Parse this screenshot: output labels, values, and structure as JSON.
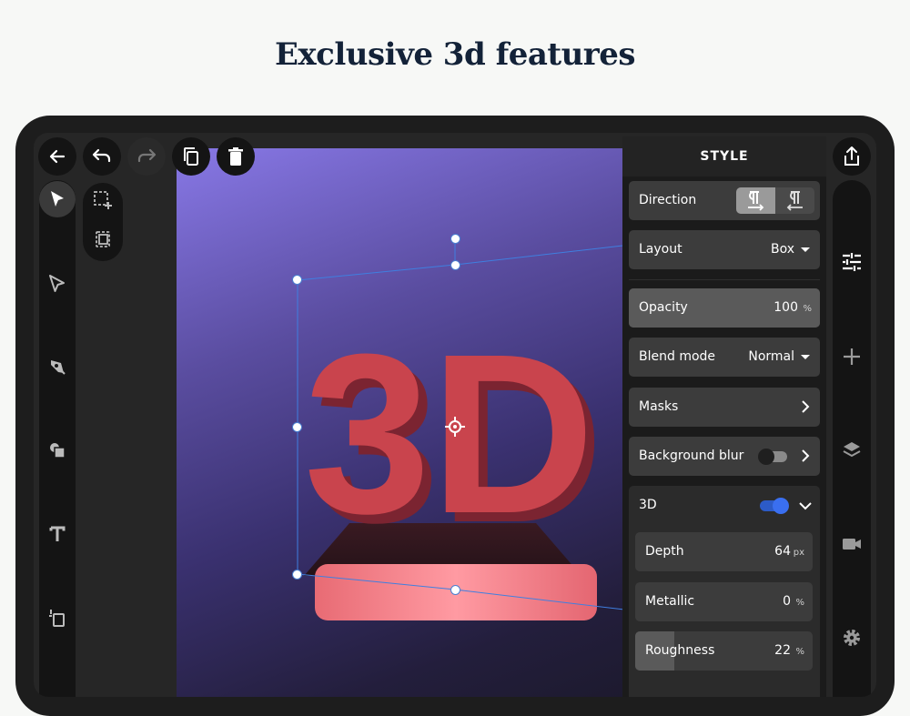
{
  "headline": "Exclusive 3d features",
  "artwork": {
    "text_3d": "3D"
  },
  "style_panel": {
    "title": "STYLE",
    "direction": {
      "label": "Direction",
      "options": [
        "ltr-paragraph-icon",
        "rtl-paragraph-icon"
      ],
      "selected": "ltr-paragraph-icon"
    },
    "layout": {
      "label": "Layout",
      "value": "Box"
    },
    "opacity": {
      "label": "Opacity",
      "value": "100",
      "unit": "%",
      "level": 1.0
    },
    "blend_mode": {
      "label": "Blend mode",
      "value": "Normal"
    },
    "masks": {
      "label": "Masks"
    },
    "background_blur": {
      "label": "Background blur",
      "enabled": false
    },
    "three_d": {
      "label": "3D",
      "enabled": true,
      "depth": {
        "label": "Depth",
        "value": "64",
        "unit": "px"
      },
      "metallic": {
        "label": "Metallic",
        "value": "0",
        "unit": "%",
        "level": 0.0
      },
      "roughness": {
        "label": "Roughness",
        "value": "22",
        "unit": "%",
        "level": 0.22
      }
    }
  },
  "colors": {
    "accent_blue": "#3a6ff0",
    "panel_bg": "#1b1b1b",
    "row_bg": "#3c3c3c",
    "text_red": "#c9444d"
  }
}
